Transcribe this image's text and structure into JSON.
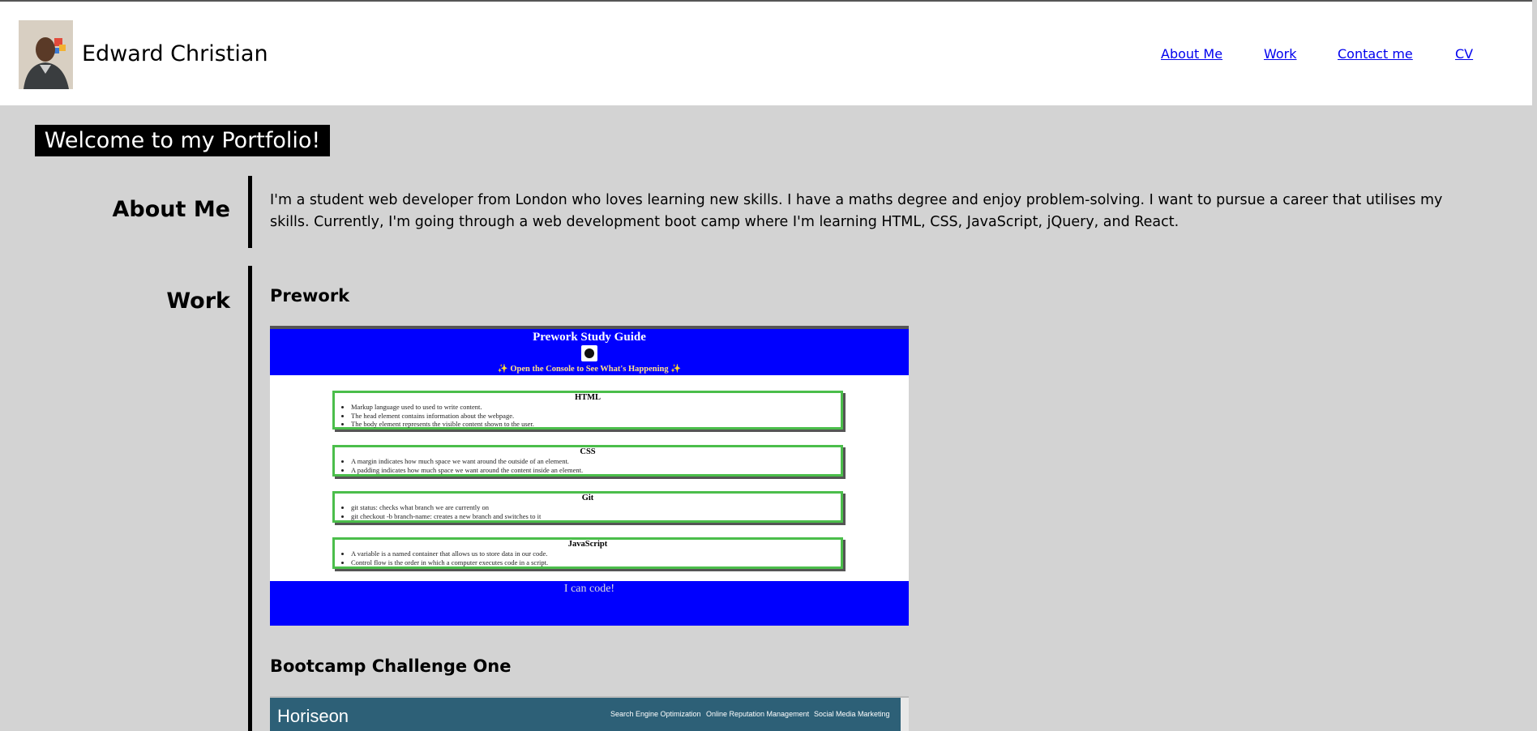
{
  "header": {
    "name": "Edward Christian",
    "nav": [
      "About Me",
      "Work",
      "Contact me",
      "CV"
    ]
  },
  "welcome": "Welcome to my Portfolio!",
  "about": {
    "label": "About Me",
    "text": "I'm a student web developer from London who loves learning new skills. I have a maths degree and enjoy problem-solving. I want to pursue a career that utilises my skills. Currently, I'm going through a web development boot camp where I'm learning HTML, CSS, JavaScript, jQuery, and React."
  },
  "work": {
    "label": "Work",
    "projects": [
      {
        "title": "Prework",
        "screenshot": {
          "heading": "Prework Study Guide",
          "subtitle": "✨ Open the Console to See What's Happening ✨",
          "cards": [
            {
              "title": "HTML",
              "items": [
                "Markup language used to used to write content.",
                "The head element contains information about the webpage.",
                "The body element represents the visible content shown to the user."
              ]
            },
            {
              "title": "CSS",
              "items": [
                "A margin indicates how much space we want around the outside of an element.",
                "A padding indicates how much space we want around the content inside an element."
              ]
            },
            {
              "title": "Git",
              "items": [
                "git status: checks what branch we are currently on",
                "git checkout -b branch-name: creates a new branch and switches to it"
              ]
            },
            {
              "title": "JavaScript",
              "items": [
                "A variable is a named container that allows us to store data in our code.",
                "Control flow is the order in which a computer executes code in a script."
              ]
            }
          ],
          "footer": "I can code!"
        }
      },
      {
        "title": "Bootcamp Challenge One",
        "screenshot": {
          "brand": "Horiseon",
          "links": [
            "Search Engine Optimization",
            "Online Reputation Management",
            "Social Media Marketing"
          ]
        }
      }
    ]
  },
  "colors": {
    "page_bg": "#d3d3d3",
    "header_bg": "#ffffff",
    "accent": "#000000",
    "prework_blue": "#0000ff",
    "card_border": "#4bbe4b",
    "horiseon_teal": "#2d6077"
  }
}
